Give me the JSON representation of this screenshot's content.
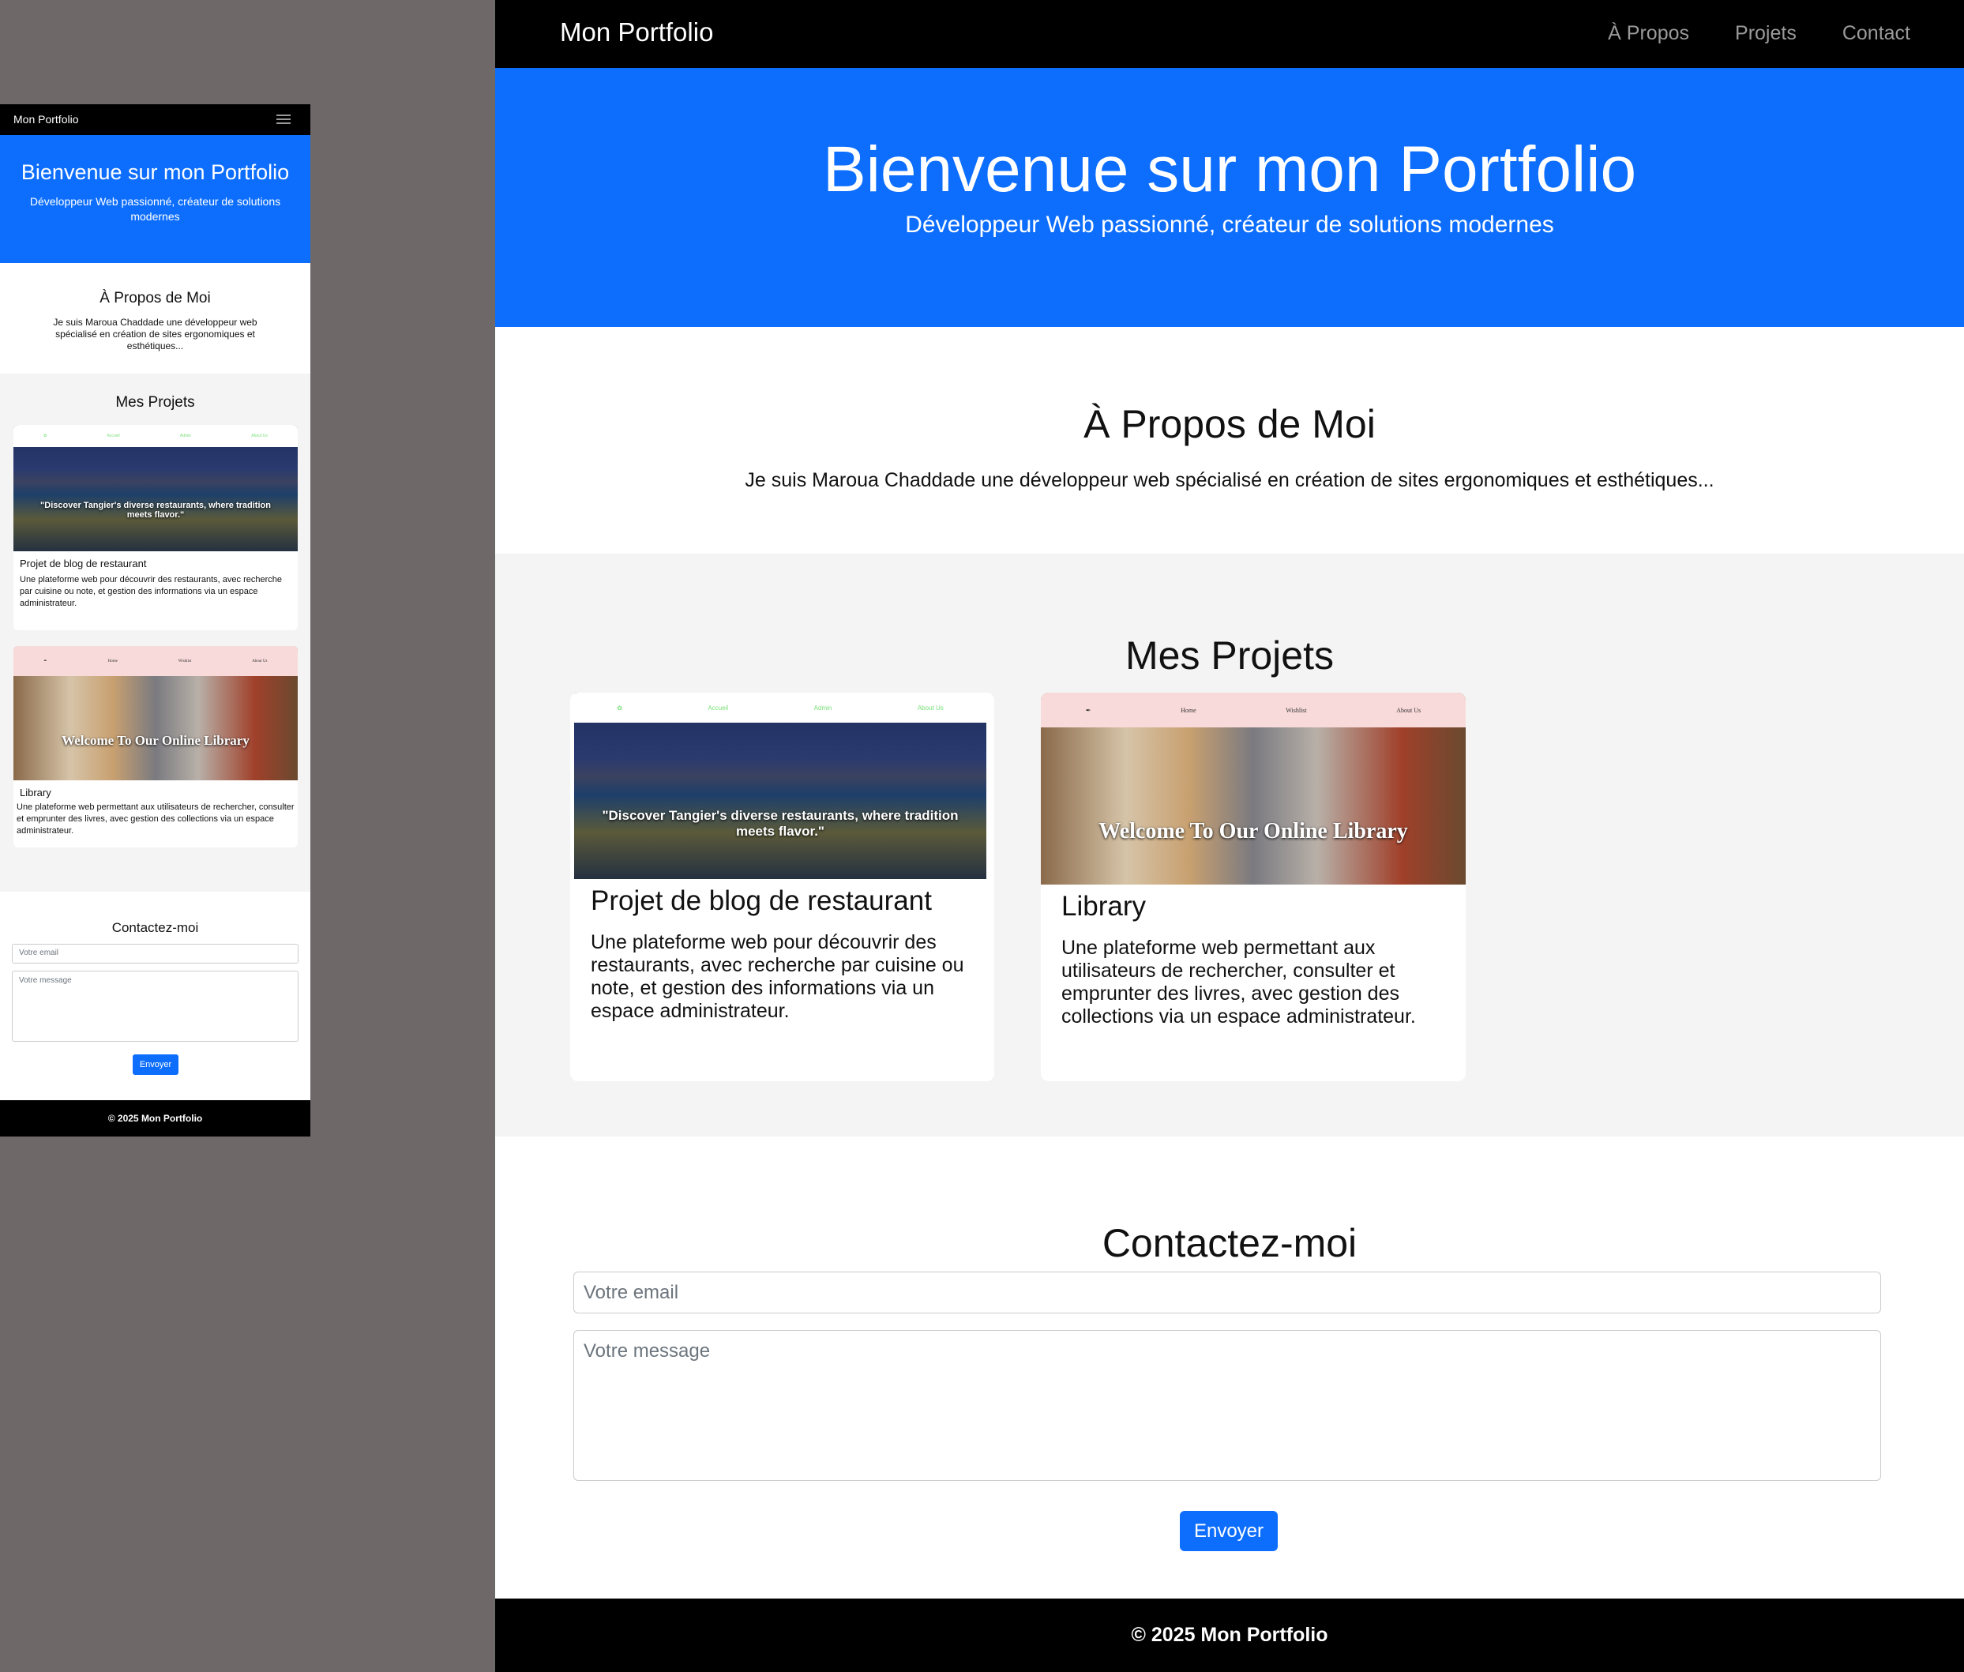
{
  "brand": "Mon Portfolio",
  "nav": {
    "links": [
      "À Propos",
      "Projets",
      "Contact"
    ]
  },
  "hero": {
    "title": "Bienvenue sur mon Portfolio",
    "subtitle": "Développeur Web passionné, créateur de solutions modernes"
  },
  "about": {
    "title": "À Propos de Moi",
    "text": "Je suis Maroua Chaddade une développeur web spécialisé en création de sites ergonomiques et esthétiques..."
  },
  "projects": {
    "title": "Mes Projets",
    "items": [
      {
        "title": "Projet de blog de restaurant",
        "description": "Une plateforme web pour découvrir des restaurants, avec recherche par cuisine ou note, et gestion des informations via un espace administrateur.",
        "overlay": "\"Discover Tangier's diverse restaurants, where tradition meets flavor.\"",
        "nav": [
          "Accueil",
          "Admin",
          "About Us"
        ]
      },
      {
        "title": "Library",
        "description": "Une plateforme web permettant aux utilisateurs de rechercher, consulter et emprunter des livres, avec gestion des collections via un espace administrateur.",
        "overlay": "Welcome To Our Online Library",
        "nav": [
          "Home",
          "Wishlist",
          "About Us"
        ]
      }
    ]
  },
  "contact": {
    "title": "Contactez-moi",
    "email_placeholder": "Votre email",
    "message_placeholder": "Votre message",
    "submit": "Envoyer"
  },
  "footer": "© 2025 Mon Portfolio",
  "colors": {
    "primary": "#0d6efd",
    "nav": "#000000",
    "section_alt": "#f4f4f4"
  }
}
